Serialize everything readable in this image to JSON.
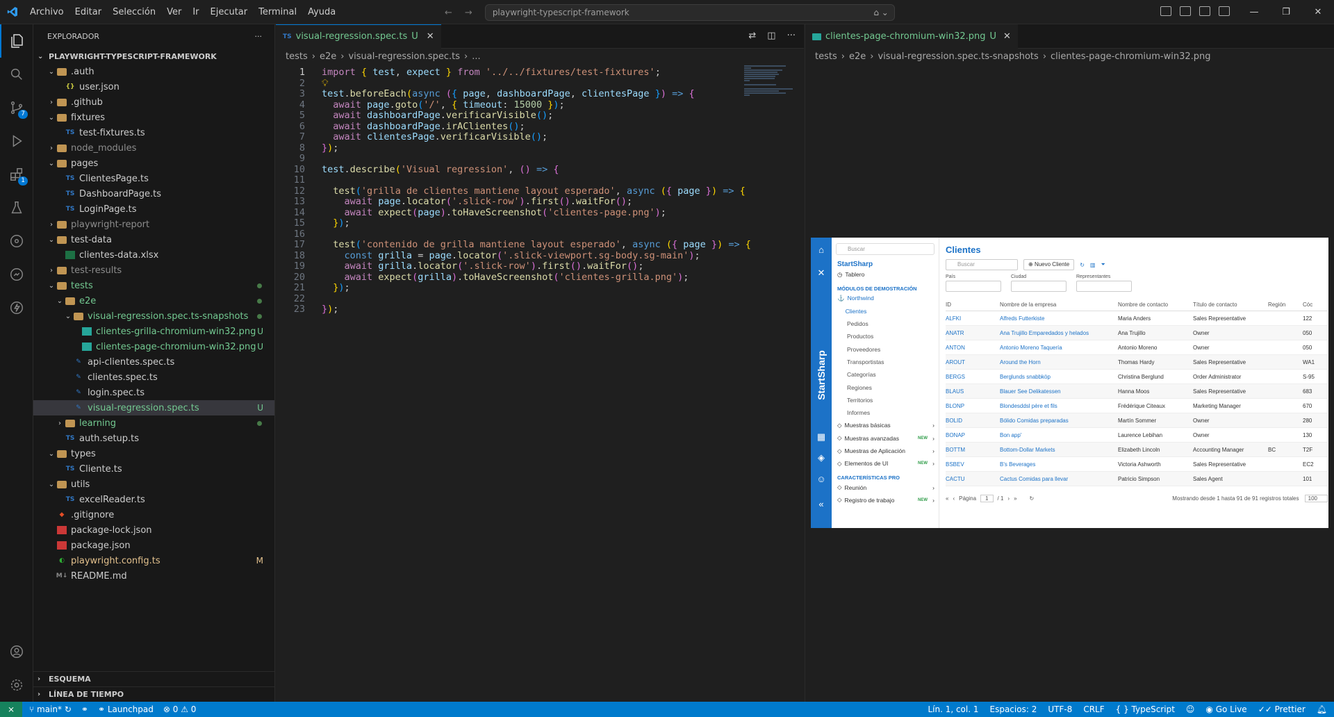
{
  "menu": [
    "Archivo",
    "Editar",
    "Selección",
    "Ver",
    "Ir",
    "Ejecutar",
    "Terminal",
    "Ayuda"
  ],
  "command_center": "playwright-typescript-framework",
  "activity": {
    "scm_badge": "7",
    "ext_badge": "1"
  },
  "sidebar": {
    "title": "EXPLORADOR",
    "root": "PLAYWRIGHT-TYPESCRIPT-FRAMEWORK",
    "items": [
      {
        "label": ".auth",
        "depth": 1,
        "type": "folder-open",
        "color": "#cca700"
      },
      {
        "label": "user.json",
        "depth": 2,
        "type": "json"
      },
      {
        "label": ".github",
        "depth": 1,
        "type": "folder"
      },
      {
        "label": "fixtures",
        "depth": 1,
        "type": "folder-open"
      },
      {
        "label": "test-fixtures.ts",
        "depth": 2,
        "type": "ts"
      },
      {
        "label": "node_modules",
        "depth": 1,
        "type": "folder",
        "dim": true
      },
      {
        "label": "pages",
        "depth": 1,
        "type": "folder-open"
      },
      {
        "label": "ClientesPage.ts",
        "depth": 2,
        "type": "ts"
      },
      {
        "label": "DashboardPage.ts",
        "depth": 2,
        "type": "ts"
      },
      {
        "label": "LoginPage.ts",
        "depth": 2,
        "type": "ts"
      },
      {
        "label": "playwright-report",
        "depth": 1,
        "type": "folder",
        "dim": true
      },
      {
        "label": "test-data",
        "depth": 1,
        "type": "folder-open"
      },
      {
        "label": "clientes-data.xlsx",
        "depth": 2,
        "type": "xlsx"
      },
      {
        "label": "test-results",
        "depth": 1,
        "type": "folder",
        "dim": true
      },
      {
        "label": "tests",
        "depth": 1,
        "type": "folder-open",
        "status": "dot",
        "git": true
      },
      {
        "label": "e2e",
        "depth": 2,
        "type": "folder-open",
        "status": "dot",
        "git": true
      },
      {
        "label": "visual-regression.spec.ts-snapshots",
        "depth": 3,
        "type": "folder-open",
        "status": "dot",
        "git": true
      },
      {
        "label": "clientes-grilla-chromium-win32.png",
        "depth": 4,
        "type": "png",
        "status": "U",
        "git": true
      },
      {
        "label": "clientes-page-chromium-win32.png",
        "depth": 4,
        "type": "png",
        "status": "U",
        "git": true
      },
      {
        "label": "api-clientes.spec.ts",
        "depth": 3,
        "type": "spec"
      },
      {
        "label": "clientes.spec.ts",
        "depth": 3,
        "type": "spec"
      },
      {
        "label": "login.spec.ts",
        "depth": 3,
        "type": "spec"
      },
      {
        "label": "visual-regression.spec.ts",
        "depth": 3,
        "type": "spec",
        "status": "U",
        "git": true,
        "selected": true
      },
      {
        "label": "learning",
        "depth": 2,
        "type": "folder",
        "status": "dot",
        "git": true
      },
      {
        "label": "auth.setup.ts",
        "depth": 2,
        "type": "ts"
      },
      {
        "label": "types",
        "depth": 1,
        "type": "folder-open"
      },
      {
        "label": "Cliente.ts",
        "depth": 2,
        "type": "ts"
      },
      {
        "label": "utils",
        "depth": 1,
        "type": "folder-open"
      },
      {
        "label": "excelReader.ts",
        "depth": 2,
        "type": "ts"
      },
      {
        "label": ".gitignore",
        "depth": 1,
        "type": "git"
      },
      {
        "label": "package-lock.json",
        "depth": 1,
        "type": "npm"
      },
      {
        "label": "package.json",
        "depth": 1,
        "type": "npm"
      },
      {
        "label": "playwright.config.ts",
        "depth": 1,
        "type": "pw",
        "status": "M",
        "modified": true
      },
      {
        "label": "README.md",
        "depth": 1,
        "type": "md"
      }
    ],
    "outline": "ESQUEMA",
    "timeline": "LÍNEA DE TIEMPO"
  },
  "editor1": {
    "tab": "visual-regression.spec.ts",
    "tab_status": "U",
    "breadcrumb": [
      "tests",
      "e2e",
      "visual-regression.spec.ts",
      "..."
    ],
    "line_numbers": [
      "1",
      "2",
      "3",
      "4",
      "5",
      "6",
      "7",
      "8",
      "9",
      "10",
      "11",
      "12",
      "13",
      "14",
      "15",
      "16",
      "17",
      "18",
      "19",
      "20",
      "21",
      "22",
      "23"
    ]
  },
  "editor2": {
    "tab": "clientes-page-chromium-win32.png",
    "tab_status": "U",
    "breadcrumb": [
      "tests",
      "e2e",
      "visual-regression.spec.ts-snapshots",
      "clientes-page-chromium-win32.png"
    ]
  },
  "preview": {
    "search": "Buscar",
    "brand": "StartSharp",
    "rail_text": "StartSharp",
    "dashboard": "Tablero",
    "demo_header": "MÓDULOS DE DEMOSTRACIÓN",
    "northwind": "Northwind",
    "sub": [
      "Clientes",
      "Pedidos",
      "Productos",
      "Proveedores",
      "Transportistas",
      "Categorías",
      "Regiones",
      "Territorios",
      "Informes"
    ],
    "groups": [
      {
        "label": "Muestras básicas",
        "new": ""
      },
      {
        "label": "Muestras avanzadas",
        "new": "NEW"
      },
      {
        "label": "Muestras de Aplicación",
        "new": ""
      },
      {
        "label": "Elementos de UI",
        "new": "NEW"
      }
    ],
    "pro_header": "CARACTERÍSTICAS PRO",
    "pro": [
      {
        "label": "Reunión",
        "new": ""
      },
      {
        "label": "Registro de trabajo",
        "new": "NEW"
      }
    ],
    "title": "Clientes",
    "grid_search": "Buscar",
    "new_button": "Nuevo Cliente",
    "filters": [
      "País",
      "Ciudad",
      "Representantes"
    ],
    "columns": [
      "ID",
      "Nombre de la empresa",
      "Nombre de contacto",
      "Título de contacto",
      "Región",
      "Cóc"
    ],
    "rows": [
      [
        "ALFKI",
        "Alfreds Futterkiste",
        "Maria Anders",
        "Sales Representative",
        "",
        "122"
      ],
      [
        "ANATR",
        "Ana Trujillo Emparedados y helados",
        "Ana Trujillo",
        "Owner",
        "",
        "050"
      ],
      [
        "ANTON",
        "Antonio Moreno Taquería",
        "Antonio Moreno",
        "Owner",
        "",
        "050"
      ],
      [
        "AROUT",
        "Around the Horn",
        "Thomas Hardy",
        "Sales Representative",
        "",
        "WA1"
      ],
      [
        "BERGS",
        "Berglunds snabbköp",
        "Christina Berglund",
        "Order Administrator",
        "",
        "S-95"
      ],
      [
        "BLAUS",
        "Blauer See Delikatessen",
        "Hanna Moos",
        "Sales Representative",
        "",
        "683"
      ],
      [
        "BLONP",
        "Blondesddsl père et fils",
        "Frédérique Citeaux",
        "Marketing Manager",
        "",
        "670"
      ],
      [
        "BOLID",
        "Bólido Comidas preparadas",
        "Martín Sommer",
        "Owner",
        "",
        "280"
      ],
      [
        "BONAP",
        "Bon app'",
        "Laurence Lebihan",
        "Owner",
        "",
        "130"
      ],
      [
        "BOTTM",
        "Bottom-Dollar Markets",
        "Elizabeth Lincoln",
        "Accounting Manager",
        "BC",
        "T2F"
      ],
      [
        "BSBEV",
        "B's Beverages",
        "Victoria Ashworth",
        "Sales Representative",
        "",
        "EC2"
      ],
      [
        "CACTU",
        "Cactus Comidas para llevar",
        "Patricio Simpson",
        "Sales Agent",
        "",
        "101"
      ]
    ],
    "page_label": "Página",
    "page_value": "1",
    "page_total": "/ 1",
    "showing": "Mostrando desde 1 hasta 91 de 91 registros totales",
    "page_size": "100"
  },
  "status": {
    "branch": "main*",
    "launchpad": "Launchpad",
    "errors": "0",
    "warnings": "0",
    "position": "Lín. 1, col. 1",
    "spaces": "Espacios: 2",
    "encoding": "UTF-8",
    "eol": "CRLF",
    "language": "TypeScript",
    "golive": "Go Live",
    "prettier": "Prettier"
  }
}
